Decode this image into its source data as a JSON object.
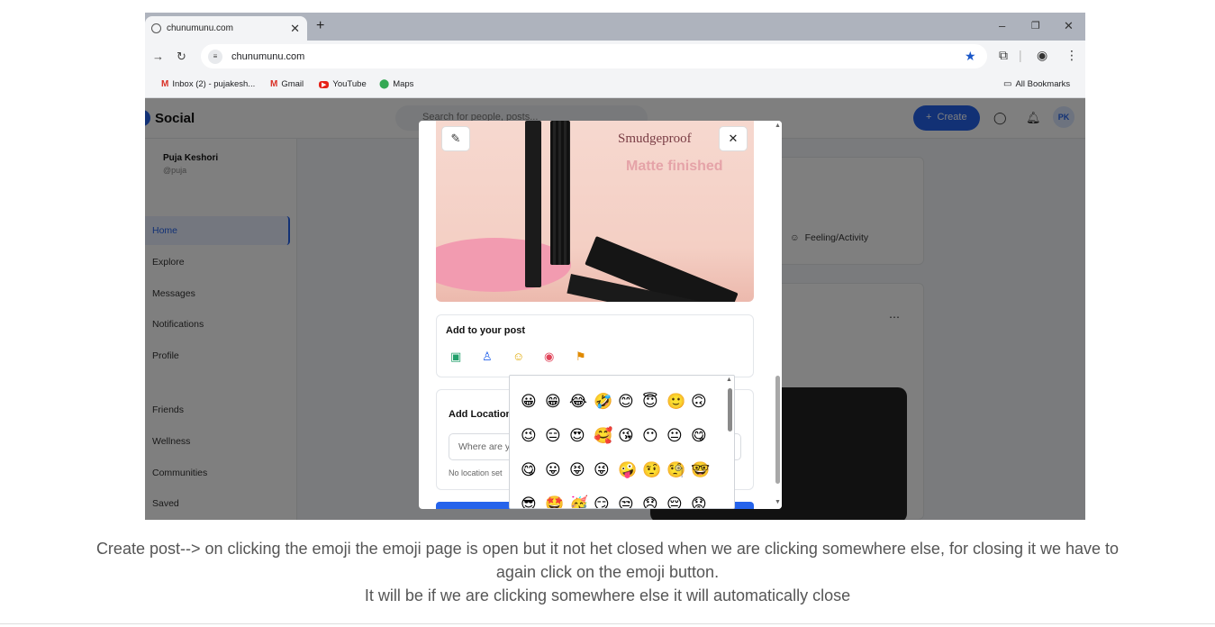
{
  "browser": {
    "tab_title": "chunumunu.com",
    "url": "chunumunu.com",
    "bookmarks": [
      {
        "label": "Inbox (2) - pujakesh...",
        "icon": "gmail-icon"
      },
      {
        "label": "Gmail",
        "icon": "gmail-icon"
      },
      {
        "label": "YouTube",
        "icon": "youtube-icon"
      },
      {
        "label": "Maps",
        "icon": "maps-icon"
      }
    ],
    "all_bookmarks": "All Bookmarks"
  },
  "app": {
    "logo": "Social",
    "search_placeholder": "Search for people, posts...",
    "create_label": "Create",
    "avatar_initials": "PK",
    "user": {
      "name": "Puja Keshori",
      "handle": "@puja"
    },
    "nav": [
      "Home",
      "Explore",
      "Messages",
      "Notifications",
      "Profile",
      "Friends",
      "Wellness",
      "Communities",
      "Saved"
    ],
    "feeling_label": "Feeling/Activity"
  },
  "modal": {
    "photo_text_1": "Smudgeproof",
    "photo_text_2": "Matte finished",
    "add_to_post": "Add to your post",
    "add_location": "Add Location",
    "location_placeholder": "Where are you?",
    "location_hint": "No location set",
    "emojis": [
      "😀",
      "😁",
      "😂",
      "🤣",
      "😊",
      "😇",
      "🙂",
      "🙃",
      "😉",
      "😑",
      "😍",
      "🥰",
      "😘",
      "😶",
      "😐",
      "😋",
      "😋",
      "😛",
      "😝",
      "😜",
      "🤪",
      "🤨",
      "🧐",
      "🤓",
      "😎",
      "🤩",
      "🥳",
      "😏",
      "😒",
      "😞",
      "😔",
      "😟"
    ]
  },
  "caption": {
    "line1": "Create post--> on clicking the emoji the emoji page is open but it not het closed when we are clicking somewhere else, for closing it we have to",
    "line2": "again click on the emoji button.",
    "line3": "It will be if we are clicking somewhere else it will automatically close"
  }
}
